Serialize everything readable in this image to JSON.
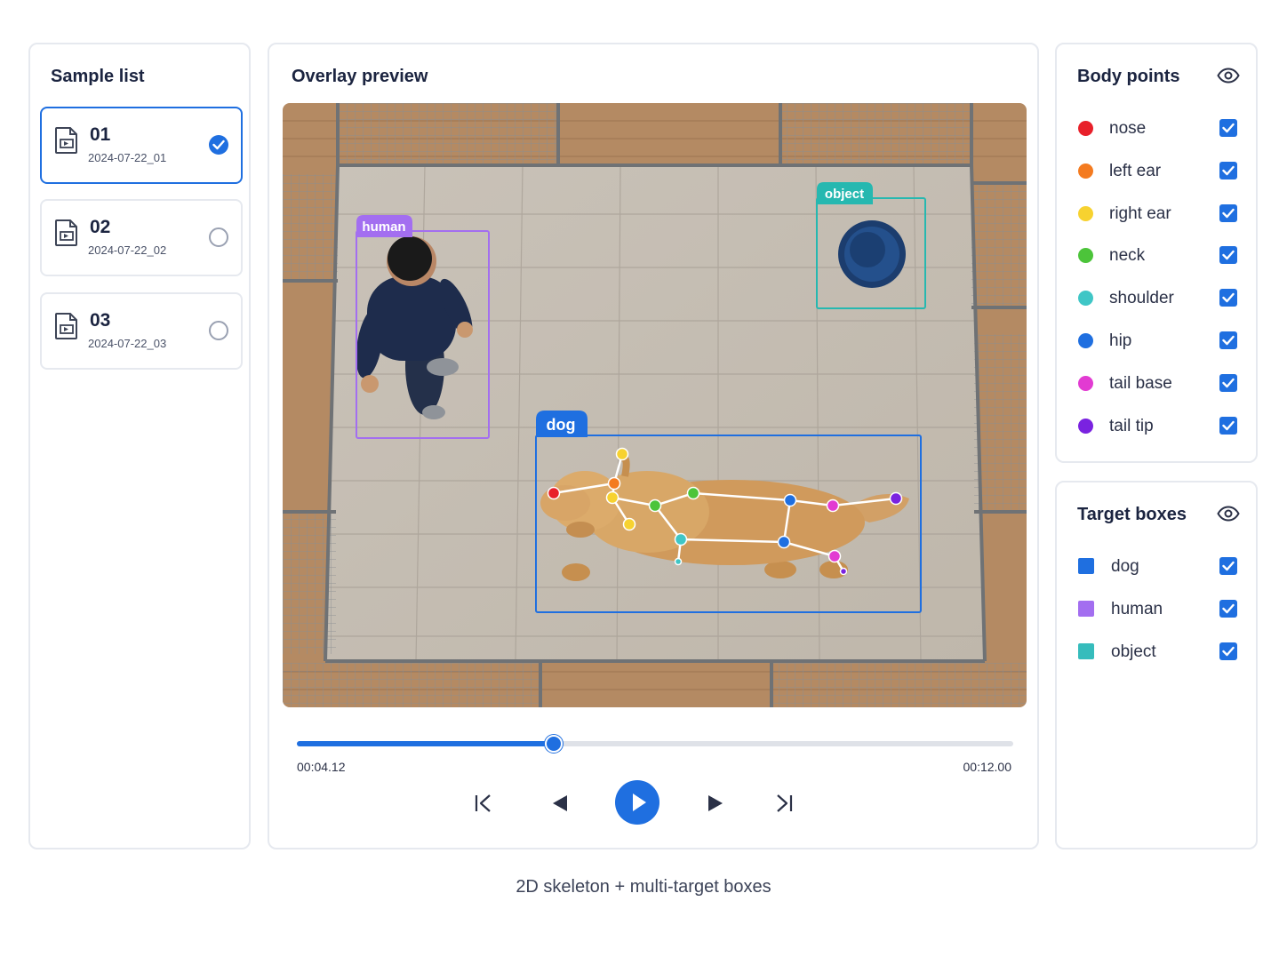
{
  "samples": {
    "title": "Sample list",
    "items": [
      {
        "id": "01",
        "date": "2024-07-22_01",
        "selected": true
      },
      {
        "id": "02",
        "date": "2024-07-22_02",
        "selected": false
      },
      {
        "id": "03",
        "date": "2024-07-22_03",
        "selected": false
      }
    ]
  },
  "preview": {
    "title": "Overlay preview",
    "boxes": {
      "human": "human",
      "object": "object",
      "dog": "dog"
    },
    "player": {
      "current_time": "00:04.12",
      "total_time": "00:12.00",
      "progress": 0.358
    }
  },
  "body_points": {
    "title": "Body points",
    "items": [
      {
        "label": "nose",
        "color": "#e8202a",
        "checked": true
      },
      {
        "label": "left ear",
        "color": "#f47b20",
        "checked": true
      },
      {
        "label": "right ear",
        "color": "#f7d230",
        "checked": true
      },
      {
        "label": "neck",
        "color": "#4cc43a",
        "checked": true
      },
      {
        "label": "shoulder",
        "color": "#3fc6c6",
        "checked": true
      },
      {
        "label": "hip",
        "color": "#1f6fe0",
        "checked": true
      },
      {
        "label": "tail base",
        "color": "#e23bd2",
        "checked": true
      },
      {
        "label": "tail tip",
        "color": "#7a22e0",
        "checked": true
      }
    ]
  },
  "target_boxes": {
    "title": "Target boxes",
    "items": [
      {
        "label": "dog",
        "color": "#1f6fe0",
        "checked": true
      },
      {
        "label": "human",
        "color": "#a36ef0",
        "checked": true
      },
      {
        "label": "object",
        "color": "#36bcbc",
        "checked": true
      }
    ]
  },
  "caption": "2D skeleton + multi-target boxes",
  "colors": {
    "accent": "#1f6fe0",
    "human_box": "#a36ef0",
    "object_box": "#26b8b0",
    "dog_box": "#1f6fe0"
  }
}
